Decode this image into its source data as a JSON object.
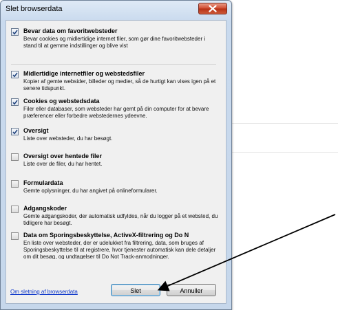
{
  "dialog": {
    "title": "Slet browserdata"
  },
  "options": [
    {
      "title": "Bevar data om favoritwebsteder",
      "checked": true,
      "description": "Bevar cookies og midlertidige internet filer, som gør dine favoritwebsteder i stand til at gemme indstillinger og blive vist"
    },
    {
      "title": "Midlertidige internetfiler og webstedsfiler",
      "checked": true,
      "description": "Kopier af gemte websider, billeder og medier, så de hurtigt kan vises igen på et senere tidspunkt."
    },
    {
      "title": "Cookies og webstedsdata",
      "checked": true,
      "description": "Filer eller databaser, som websteder har gemt på din computer for at bevare præferencer eller forbedre webstedernes ydeevne."
    },
    {
      "title": "Oversigt",
      "checked": true,
      "description": "Liste over websteder, du har besøgt."
    },
    {
      "title": "Oversigt over hentede filer",
      "checked": false,
      "description": "Liste over de filer, du har hentet."
    },
    {
      "title": "Formulardata",
      "checked": false,
      "description": "Gemte oplysninger, du har angivet på onlineformularer."
    },
    {
      "title": "Adgangskoder",
      "checked": false,
      "description": "Gemte adgangskoder, der automatisk udfyldes, når du logger på et websted, du tidligere har besøgt."
    },
    {
      "title": "Data om Sporingsbeskyttelse, ActiveX-filtrering og Do N",
      "checked": false,
      "description": "En liste over websteder, der er udelukket fra filtrering, data, som bruges af Sporingsbeskyttelse til at registrere, hvor tjenester automatisk kan dele detaljer om dit besøg, og undtagelser til Do Not Track-anmodninger."
    }
  ],
  "footer": {
    "link_label": "Om sletning af browserdata",
    "delete_label": "Slet",
    "cancel_label": "Annuller"
  },
  "colors": {
    "link": "#0b35c9",
    "close_button": "#c8442b",
    "frame": "#c6d7eb"
  },
  "icons": [
    "close-icon",
    "checkmark-icon",
    "annotation-arrow"
  ]
}
